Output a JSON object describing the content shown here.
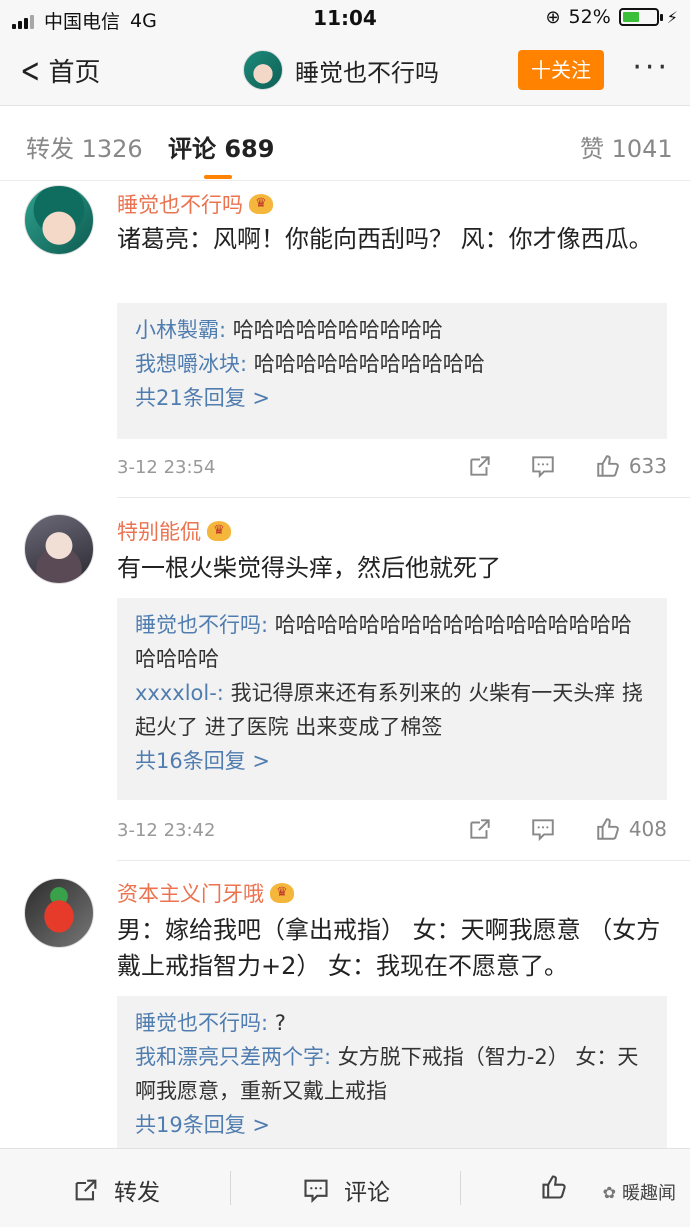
{
  "status_bar": {
    "carrier": "中国电信",
    "network": "4G",
    "time": "11:04",
    "battery": "52%",
    "battery_level": 0.52
  },
  "nav": {
    "back_label": "首页",
    "title": "睡觉也不行吗",
    "follow_label": "十关注",
    "more_label": "···"
  },
  "tabs": {
    "repost": "转发 1326",
    "comment": "评论 689",
    "like": "赞 1041"
  },
  "comments": [
    {
      "user": "睡觉也不行吗",
      "text": "诸葛亮：风啊！你能向西刮吗？ 风：你才像西瓜。",
      "replies": [
        {
          "name": "小林製霸:",
          "text": " 哈哈哈哈哈哈哈哈哈哈"
        },
        {
          "name": "我想嚼冰块:",
          "text": " 哈哈哈哈哈哈哈哈哈哈哈"
        }
      ],
      "more_replies": "共21条回复 >",
      "time": "3-12 23:54",
      "likes": "633"
    },
    {
      "user": "特别能侃",
      "text": "有一根火柴觉得头痒，然后他就死了",
      "replies": [
        {
          "name": "睡觉也不行吗:",
          "text": " 哈哈哈哈哈哈哈哈哈哈哈哈哈哈哈哈哈哈哈哈哈"
        },
        {
          "name": "xxxxlol-:",
          "text": " 我记得原来还有系列来的 火柴有一天头痒 挠起火了 进了医院 出来变成了棉签"
        }
      ],
      "more_replies": "共16条回复 >",
      "time": "3-12 23:42",
      "likes": "408"
    },
    {
      "user": "资本主义门牙哦",
      "text": "男：嫁给我吧（拿出戒指） 女：天啊我愿意 （女方戴上戒指智力+2） 女：我现在不愿意了。",
      "replies": [
        {
          "name": "睡觉也不行吗:",
          "text": " ?"
        },
        {
          "name": "我和漂亮只差两个字:",
          "text": " 女方脱下戒指（智力-2） 女：天啊我愿意，重新又戴上戒指"
        }
      ],
      "more_replies": "共19条回复 >"
    }
  ],
  "bottom_bar": {
    "repost": "转发",
    "comment": "评论",
    "watermark": "暖趣闻"
  },
  "icons": {
    "share": "share-icon",
    "comment": "comment-icon",
    "like": "thumb-up-icon",
    "vip": "crown-icon"
  },
  "colors": {
    "accent": "#ff8200",
    "username": "#eb7350",
    "reply_name": "#507daf"
  }
}
